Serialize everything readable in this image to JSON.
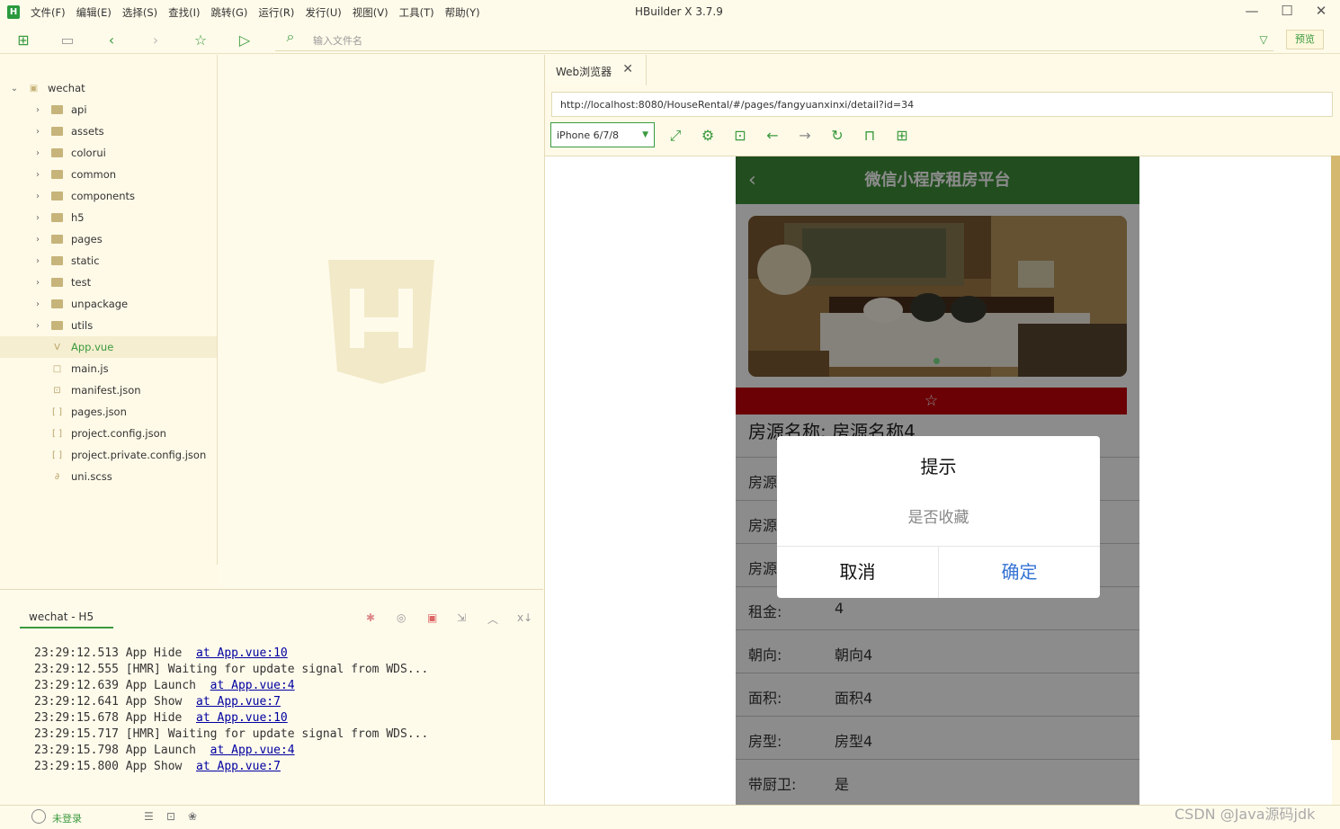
{
  "app": {
    "title": "HBuilder X 3.7.9",
    "logo": "H"
  },
  "menu": [
    "文件(F)",
    "编辑(E)",
    "选择(S)",
    "查找(I)",
    "跳转(G)",
    "运行(R)",
    "发行(U)",
    "视图(V)",
    "工具(T)",
    "帮助(Y)"
  ],
  "toolbar": {
    "file_placeholder": "输入文件名",
    "preview": "预览"
  },
  "tree": {
    "root": "wechat",
    "folders": [
      "api",
      "assets",
      "colorui",
      "common",
      "components",
      "h5",
      "pages",
      "static",
      "test",
      "unpackage",
      "utils"
    ],
    "files": [
      {
        "name": "App.vue",
        "icon": "V",
        "selected": true
      },
      {
        "name": "main.js",
        "icon": "□"
      },
      {
        "name": "manifest.json",
        "icon": "⊡"
      },
      {
        "name": "pages.json",
        "icon": "[ ]"
      },
      {
        "name": "project.config.json",
        "icon": "[ ]"
      },
      {
        "name": "project.private.config.json",
        "icon": "[ ]"
      },
      {
        "name": "uni.scss",
        "icon": "∂"
      }
    ]
  },
  "console": {
    "tab": "wechat - H5",
    "lines": [
      {
        "time": "23:29:12.513",
        "msg": "App Hide  ",
        "link": "at App.vue:10"
      },
      {
        "time": "23:29:12.555",
        "msg": "[HMR] Waiting for update signal from WDS...",
        "link": ""
      },
      {
        "time": "23:29:12.639",
        "msg": "App Launch  ",
        "link": "at App.vue:4"
      },
      {
        "time": "23:29:12.641",
        "msg": "App Show  ",
        "link": "at App.vue:7"
      },
      {
        "time": "23:29:15.678",
        "msg": "App Hide  ",
        "link": "at App.vue:10"
      },
      {
        "time": "23:29:15.717",
        "msg": "[HMR] Waiting for update signal from WDS...",
        "link": ""
      },
      {
        "time": "23:29:15.798",
        "msg": "App Launch  ",
        "link": "at App.vue:4"
      },
      {
        "time": "23:29:15.800",
        "msg": "App Show  ",
        "link": "at App.vue:7"
      }
    ]
  },
  "browser": {
    "tab": "Web浏览器",
    "url": "http://localhost:8080/HouseRental/#/pages/fangyuanxinxi/detail?id=34",
    "device": "iPhone 6/7/8"
  },
  "phone": {
    "header": "微信小程序租房平台",
    "name_label": "房源名称:",
    "name_value": "房源名称4",
    "rows": [
      {
        "k": "房源",
        "v": ""
      },
      {
        "k": "房源",
        "v": ""
      },
      {
        "k": "房源",
        "v": ""
      },
      {
        "k": "租金:",
        "v": "4"
      },
      {
        "k": "朝向:",
        "v": "朝向4"
      },
      {
        "k": "面积:",
        "v": "面积4"
      },
      {
        "k": "房型:",
        "v": "房型4"
      },
      {
        "k": "带厨卫:",
        "v": "是"
      }
    ],
    "modal": {
      "title": "提示",
      "content": "是否收藏",
      "cancel": "取消",
      "confirm": "确定"
    }
  },
  "status": {
    "login": "未登录"
  },
  "watermark": "CSDN @Java源码jdk"
}
